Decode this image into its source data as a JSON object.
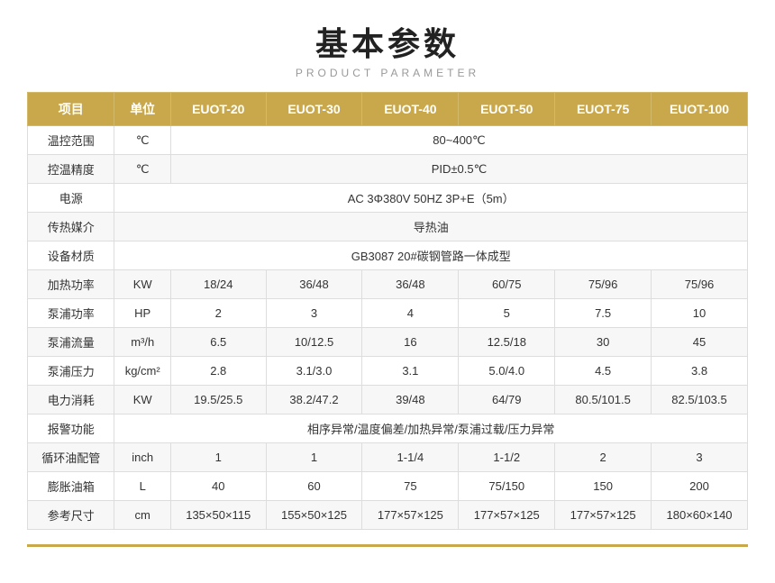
{
  "header": {
    "main_title": "基本参数",
    "sub_title": "PRODUCT PARAMETER"
  },
  "table": {
    "columns": [
      "项目",
      "单位",
      "EUOT-20",
      "EUOT-30",
      "EUOT-40",
      "EUOT-50",
      "EUOT-75",
      "EUOT-100"
    ],
    "rows": [
      {
        "item": "温控范围",
        "unit": "℃",
        "values": [
          "80~400℃"
        ],
        "span": 6
      },
      {
        "item": "控温精度",
        "unit": "℃",
        "values": [
          "PID±0.5℃"
        ],
        "span": 6
      },
      {
        "item": "电源",
        "unit": "",
        "values": [
          "AC 3Φ380V 50HZ 3P+E（5m）"
        ],
        "span": 7
      },
      {
        "item": "传热媒介",
        "unit": "",
        "values": [
          "导热油"
        ],
        "span": 7
      },
      {
        "item": "设备材质",
        "unit": "",
        "values": [
          "GB3087   20#碳钢管路一体成型"
        ],
        "span": 7
      },
      {
        "item": "加热功率",
        "unit": "KW",
        "values": [
          "18/24",
          "36/48",
          "36/48",
          "60/75",
          "75/96",
          "75/96"
        ]
      },
      {
        "item": "泵浦功率",
        "unit": "HP",
        "values": [
          "2",
          "3",
          "4",
          "5",
          "7.5",
          "10"
        ]
      },
      {
        "item": "泵浦流量",
        "unit": "m³/h",
        "values": [
          "6.5",
          "10/12.5",
          "16",
          "12.5/18",
          "30",
          "45"
        ]
      },
      {
        "item": "泵浦压力",
        "unit": "kg/cm²",
        "values": [
          "2.8",
          "3.1/3.0",
          "3.1",
          "5.0/4.0",
          "4.5",
          "3.8"
        ]
      },
      {
        "item": "电力消耗",
        "unit": "KW",
        "values": [
          "19.5/25.5",
          "38.2/47.2",
          "39/48",
          "64/79",
          "80.5/101.5",
          "82.5/103.5"
        ]
      },
      {
        "item": "报警功能",
        "unit": "",
        "values": [
          "相序异常/温度偏差/加热异常/泵浦过载/压力异常"
        ],
        "span": 7
      },
      {
        "item": "循环油配管",
        "unit": "inch",
        "values": [
          "1",
          "1",
          "1-1/4",
          "1-1/2",
          "2",
          "3"
        ]
      },
      {
        "item": "膨胀油箱",
        "unit": "L",
        "values": [
          "40",
          "60",
          "75",
          "75/150",
          "150",
          "200"
        ]
      },
      {
        "item": "参考尺寸",
        "unit": "cm",
        "values": [
          "135×50×115",
          "155×50×125",
          "177×57×125",
          "177×57×125",
          "177×57×125",
          "180×60×140"
        ]
      }
    ]
  }
}
